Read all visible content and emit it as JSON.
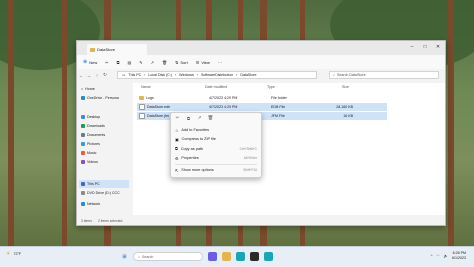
{
  "window": {
    "tab_title": "DataStore",
    "controls": [
      "–",
      "□",
      "✕"
    ]
  },
  "commandbar": {
    "new_label": "New",
    "sort_label": "Sort",
    "view_label": "View",
    "more_label": "···"
  },
  "addressbar": {
    "crumbs": [
      "This PC",
      "Local Disk (C:)",
      "Windows",
      "SoftwareDistribution",
      "DataStore"
    ],
    "search_placeholder": "Search DataStore"
  },
  "navpane": {
    "items": [
      {
        "label": "Home"
      },
      {
        "label": "OneDrive - Persona"
      },
      {
        "label": "Desktop"
      },
      {
        "label": "Downloads"
      },
      {
        "label": "Documents"
      },
      {
        "label": "Pictures"
      },
      {
        "label": "Music"
      },
      {
        "label": "Videos"
      },
      {
        "label": "This PC"
      },
      {
        "label": "DVD Drive (D:) CCC"
      },
      {
        "label": "Network"
      }
    ]
  },
  "columns": {
    "name": "Name",
    "modified": "Date modified",
    "type": "Type",
    "size": "Size"
  },
  "files": [
    {
      "name": "Logs",
      "modified": "4/7/2023 4:29 PM",
      "type": "File folder",
      "size": ""
    },
    {
      "name": "DataStore.edb",
      "modified": "4/7/2023 4:29 PM",
      "type": "EDB File",
      "size": "28,160 KB"
    },
    {
      "name": "DataStore.jfm",
      "modified": "4/7/2023 4:29 PM",
      "type": "JFM File",
      "size": "16 KB"
    }
  ],
  "context_menu": {
    "items": [
      {
        "label": "Add to Favorites",
        "shortcut": ""
      },
      {
        "label": "Compress to ZIP file",
        "shortcut": ""
      },
      {
        "label": "Copy as path",
        "shortcut": "Ctrl+Shift+C"
      },
      {
        "label": "Properties",
        "shortcut": "Alt+Enter"
      },
      {
        "label": "Show more options",
        "shortcut": "Shift+F10"
      }
    ]
  },
  "statusbar": {
    "count": "3 items",
    "selected": "2 items selected"
  },
  "taskbar": {
    "weather": "72°F",
    "search_placeholder": "Search",
    "time": "6:28 PM",
    "date": "6/1/2023"
  },
  "colors": {
    "accent": "#0067c0",
    "selection": "#cfe2f7",
    "folder": "#e8b44a"
  }
}
